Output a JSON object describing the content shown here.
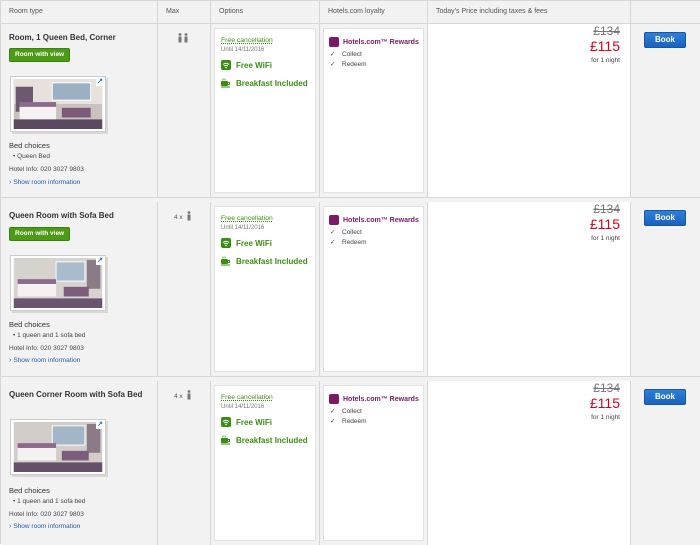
{
  "header": {
    "room_type": "Room type",
    "max": "Max",
    "options": "Options",
    "loyalty": "Hotels.com loyalty",
    "price": "Today's Price including taxes & fees"
  },
  "rooms": [
    {
      "title": "Room, 1 Queen Bed, Corner",
      "view_label": "Room with view",
      "bed_choices_label": "Bed choices",
      "beds": [
        "Queen Bed"
      ],
      "hotel_info": "Hotel Info: 020 3027 9803",
      "show_more": "Show room information",
      "max_text": "",
      "options": {
        "free_cancel": "Free cancellation",
        "until": "Until 14/11/2016",
        "wifi": "Free WiFi",
        "breakfast": "Breakfast Included"
      },
      "loyalty": {
        "brand": "Hotels.com™ Rewards",
        "collect": "Collect",
        "redeem": "Redeem"
      },
      "price": {
        "old": "£134",
        "new": "£115",
        "per": "for 1 night"
      },
      "book_label": "Book"
    },
    {
      "title": "Queen Room with Sofa Bed",
      "view_label": "Room with view",
      "bed_choices_label": "Bed choices",
      "beds": [
        "1 queen and 1 sofa bed"
      ],
      "hotel_info": "Hotel Info: 020 3027 9803",
      "show_more": "Show room information",
      "max_text": "4 x",
      "options": {
        "free_cancel": "Free cancellation",
        "until": "Until 14/11/2016",
        "wifi": "Free WiFi",
        "breakfast": "Breakfast Included"
      },
      "loyalty": {
        "brand": "Hotels.com™ Rewards",
        "collect": "Collect",
        "redeem": "Redeem"
      },
      "price": {
        "old": "£134",
        "new": "£115",
        "per": "for 1 night"
      },
      "book_label": "Book"
    },
    {
      "title": "Queen Corner Room with Sofa Bed",
      "view_label": "",
      "bed_choices_label": "Bed choices",
      "beds": [
        "1 queen and 1 sofa bed"
      ],
      "hotel_info": "Hotel Info: 020 3027 9803",
      "show_more": "Show room information",
      "max_text": "4 x",
      "options": {
        "free_cancel": "Free cancellation",
        "until": "Until 14/11/2016",
        "wifi": "Free WiFi",
        "breakfast": "Breakfast Included"
      },
      "loyalty": {
        "brand": "Hotels.com™ Rewards",
        "collect": "Collect",
        "redeem": "Redeem"
      },
      "price": {
        "old": "£134",
        "new": "£115",
        "per": "for 1 night"
      },
      "book_label": "Book"
    }
  ],
  "colors": {
    "accent_green": "#4d9b14",
    "rewards_purple": "#7a1966",
    "price_red": "#d0021b",
    "book_blue": "#1a62bd"
  },
  "icons": {
    "guests": "person-icon",
    "wifi": "wifi-icon",
    "breakfast": "coffee-cup-icon",
    "rewards": "hotels-rewards-icon",
    "check": "check-icon",
    "expand": "expand-arrow-icon"
  }
}
